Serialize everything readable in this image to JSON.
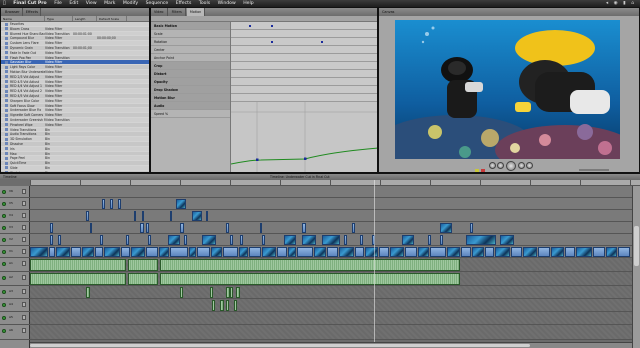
{
  "menubar": {
    "apple": "",
    "app_name": "Final Cut Pro",
    "items": [
      "File",
      "Edit",
      "View",
      "Mark",
      "Modify",
      "Sequence",
      "Effects",
      "Tools",
      "Window",
      "Help"
    ],
    "status": "◂ ◉ ▮ ⌂"
  },
  "browser": {
    "tabs": [
      "Browser",
      "Effects"
    ],
    "columns": [
      "Name",
      "Type",
      "Length",
      "Default Scale"
    ],
    "rows": [
      {
        "name": "Favorites",
        "type": "",
        "len": "",
        "ext": ""
      },
      {
        "name": "Bloom Cross",
        "type": "Video Filter",
        "len": "",
        "ext": ""
      },
      {
        "name": "Blurred Hue Sharp Back",
        "type": "Video Transition",
        "len": "00:00:01;00",
        "ext": ""
      },
      {
        "name": "Compound Blur",
        "type": "Video Filter",
        "len": "",
        "ext": "00:00:00;00"
      },
      {
        "name": "Custom Lens Flare",
        "type": "Video Filter",
        "len": "",
        "ext": ""
      },
      {
        "name": "Dynamic Grain",
        "type": "Video Transition",
        "len": "00:00:01;00",
        "ext": ""
      },
      {
        "name": "Fade In Fade Out",
        "type": "Video Filter",
        "len": "",
        "ext": ""
      },
      {
        "name": "Flash Pop Pan",
        "type": "Video Transition",
        "len": "",
        "ext": ""
      },
      {
        "name": "Gaussian Blur",
        "type": "Video Filter",
        "len": "",
        "ext": ""
      },
      {
        "name": "Light Rays Color",
        "type": "Video Filter",
        "len": "",
        "ext": ""
      },
      {
        "name": "Motion Blur Underwater",
        "type": "Video Filter",
        "len": "",
        "ext": ""
      },
      {
        "name": "RED 2/3 Vid Adjust",
        "type": "Video Filter",
        "len": "",
        "ext": ""
      },
      {
        "name": "RED 4/3 Vid Adjust",
        "type": "Video Filter",
        "len": "",
        "ext": ""
      },
      {
        "name": "RED 4/4 Vid Adjust 1",
        "type": "Video Filter",
        "len": "",
        "ext": ""
      },
      {
        "name": "RED 4/4 Vid Adjust 2",
        "type": "Video Filter",
        "len": "",
        "ext": ""
      },
      {
        "name": "RED 4/5 Vid Adjust",
        "type": "Video Filter",
        "len": "",
        "ext": ""
      },
      {
        "name": "Sharpen Blur Color",
        "type": "Video Filter",
        "len": "",
        "ext": ""
      },
      {
        "name": "Soft Focus Glow",
        "type": "Video Filter",
        "len": "",
        "ext": ""
      },
      {
        "name": "Underwater Blue Fix",
        "type": "Video Filter",
        "len": "",
        "ext": ""
      },
      {
        "name": "Vignette Soft Corners",
        "type": "Video Filter",
        "len": "",
        "ext": ""
      },
      {
        "name": "Underwater Greenish Fix",
        "type": "Video Transition",
        "len": "",
        "ext": ""
      },
      {
        "name": "Pinwheel Wipe",
        "type": "Video Filter",
        "len": "",
        "ext": ""
      },
      {
        "name": "Video Transitions",
        "type": "Bin",
        "len": "",
        "ext": ""
      },
      {
        "name": "Audio Transitions",
        "type": "Bin",
        "len": "",
        "ext": ""
      },
      {
        "name": "3D Simulation",
        "type": "Bin",
        "len": "",
        "ext": ""
      },
      {
        "name": "Dissolve",
        "type": "Bin",
        "len": "",
        "ext": ""
      },
      {
        "name": "Iris",
        "type": "Bin",
        "len": "",
        "ext": ""
      },
      {
        "name": "Map",
        "type": "Bin",
        "len": "",
        "ext": ""
      },
      {
        "name": "Page Peel",
        "type": "Bin",
        "len": "",
        "ext": ""
      },
      {
        "name": "QuickTime",
        "type": "Bin",
        "len": "",
        "ext": ""
      },
      {
        "name": "Slide",
        "type": "Bin",
        "len": "",
        "ext": ""
      },
      {
        "name": "Stretch",
        "type": "Bin",
        "len": "",
        "ext": ""
      },
      {
        "name": "Wipe",
        "type": "Bin",
        "len": "",
        "ext": ""
      },
      {
        "name": "Audio Filters",
        "type": "Bin",
        "len": "",
        "ext": ""
      },
      {
        "name": "Adjustment Layers",
        "type": "Video Filter",
        "len": "",
        "ext": ""
      },
      {
        "name": "Black Level Adjust",
        "type": "Video Filter",
        "len": "",
        "ext": ""
      },
      {
        "name": "Channel Mixer",
        "type": "Video Filter",
        "len": "",
        "ext": ""
      },
      {
        "name": "Color Correct 3-Way",
        "type": "Video Filter",
        "len": "",
        "ext": ""
      },
      {
        "name": "Enhanced Image RGB",
        "type": "Video Filter",
        "len": "",
        "ext": ""
      },
      {
        "name": "Levels Independent",
        "type": "Video Filter",
        "len": "",
        "ext": ""
      },
      {
        "name": "Luma Keyer",
        "type": "Video Filter",
        "len": "",
        "ext": ""
      }
    ],
    "selected_index": 8
  },
  "viewer": {
    "tabs": [
      "Video",
      "Filters",
      "Motion"
    ],
    "params": [
      {
        "name": "Basic Motion",
        "header": true
      },
      {
        "name": "Scale",
        "header": false
      },
      {
        "name": "Rotation",
        "header": false
      },
      {
        "name": "Center",
        "header": false
      },
      {
        "name": "Anchor Point",
        "header": false
      },
      {
        "name": "Crop",
        "header": true
      },
      {
        "name": "Distort",
        "header": true
      },
      {
        "name": "Opacity",
        "header": true
      },
      {
        "name": "Drop Shadow",
        "header": true
      },
      {
        "name": "Motion Blur",
        "header": true
      },
      {
        "name": "Audio",
        "header": true
      },
      {
        "name": "Speed %",
        "header": false
      }
    ]
  },
  "canvas": {
    "tab": "Canvas"
  },
  "timeline": {
    "tab": "Timeline",
    "title": "Timeline: Underwater Cut in Final Cut",
    "track_labels": [
      "V6",
      "V5",
      "V4",
      "V3",
      "V2",
      "V1",
      "A1",
      "A2",
      "A3",
      "A4",
      "A5",
      "A6"
    ]
  },
  "colors": {
    "selection": "#3a66b5",
    "video_clip": "#7fa6d6",
    "audio_clip": "#8fbf8f",
    "track_on": "#3aa03a"
  },
  "icons": {
    "play": "play-icon",
    "keyframe": "keyframe-icon",
    "lock": "lock-icon",
    "track_visibility": "track-visibility-icon"
  }
}
